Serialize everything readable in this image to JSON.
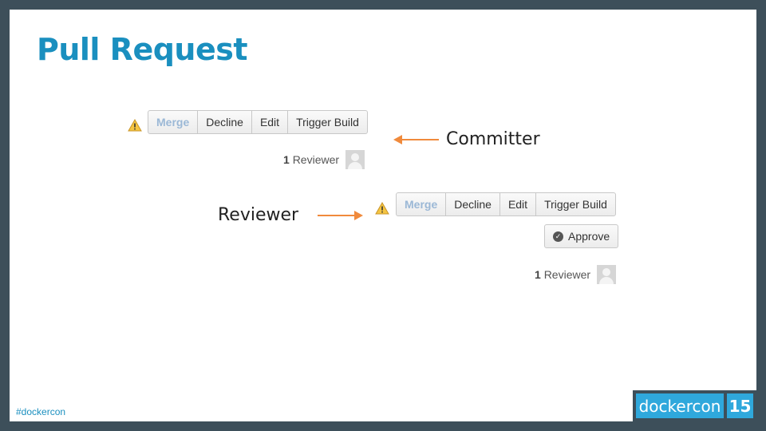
{
  "slide": {
    "title": "Pull Request",
    "hashtag": "#dockercon",
    "brand_word": "dockercon",
    "brand_number": "15"
  },
  "committer_view": {
    "buttons": [
      "Merge",
      "Decline",
      "Edit",
      "Trigger Build"
    ],
    "reviewer_count": "1",
    "reviewer_label": "Reviewer",
    "callout": "Committer"
  },
  "reviewer_view": {
    "buttons": [
      "Merge",
      "Decline",
      "Edit",
      "Trigger Build"
    ],
    "approve_label": "Approve",
    "reviewer_count": "1",
    "reviewer_label": "Reviewer",
    "callout": "Reviewer"
  },
  "colors": {
    "title": "#1a8fbf",
    "arrow": "#f08a3c",
    "frame": "#3d4f5a",
    "brand": "#2fa8dc",
    "merge_disabled": "#9bb8d6"
  },
  "icons": [
    "warning-icon",
    "avatar-icon",
    "check-circle-icon",
    "arrow-left-icon",
    "arrow-right-icon"
  ]
}
